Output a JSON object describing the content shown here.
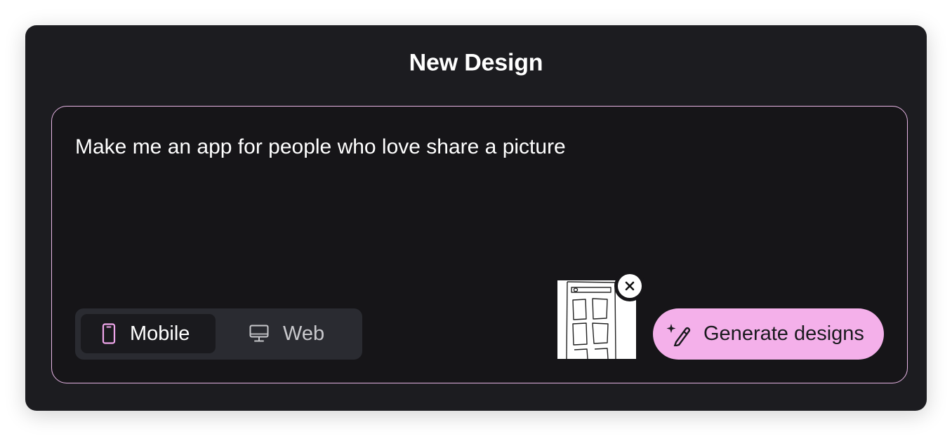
{
  "dialog": {
    "title": "New Design"
  },
  "prompt": {
    "value": "Make me an app for people who love share a picture"
  },
  "device_toggle": {
    "selected": "Mobile",
    "options": [
      {
        "label": "Mobile",
        "icon": "smartphone-icon"
      },
      {
        "label": "Web",
        "icon": "monitor-icon"
      }
    ]
  },
  "attachment": {
    "thumbnail_icon": "sketch-thumbnail",
    "remove_icon": "close-icon"
  },
  "generate": {
    "label": "Generate designs",
    "icon": "magic-wand-icon"
  },
  "colors": {
    "dialog_bg": "#1c1c20",
    "prompt_border": "#e8b6e6",
    "accent": "#f4b0ea",
    "mobile_icon": "#f0a6ec"
  }
}
